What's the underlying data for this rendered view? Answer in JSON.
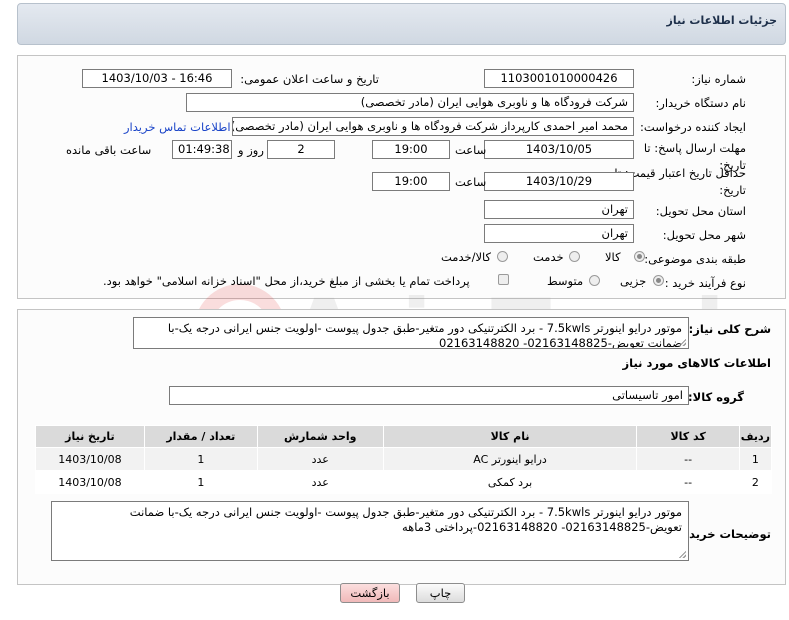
{
  "header": {
    "title": "جزئیات اطلاعات نیاز"
  },
  "form": {
    "need_number_label": "شماره نیاز:",
    "need_number": "1103001010000426",
    "announce_label": "تاریخ و ساعت اعلان عمومی:",
    "announce_value": "1403/10/03 - 16:46",
    "buyer_org_label": "نام دستگاه خریدار:",
    "buyer_org": "شرکت فرودگاه ها و ناوبری هوایی ایران (مادر تخصصی)",
    "creator_label": "ایجاد کننده درخواست:",
    "creator": "محمد امیر احمدی کارپرداز شرکت فرودگاه ها و ناوبری هوایی ایران (مادر تخصصی)",
    "contact_link": "اطلاعات تماس خریدار",
    "reply_deadline_label": "مهلت ارسال پاسخ: تا تاریخ:",
    "reply_date": "1403/10/05",
    "time_label": "ساعت",
    "reply_time": "19:00",
    "days_value": "2",
    "days_label": "روز و",
    "remaining_time": "01:49:38",
    "remaining_label": "ساعت باقی مانده",
    "price_validity_label": "حداقل تاریخ اعتبار قیمت: تا تاریخ:",
    "price_date": "1403/10/29",
    "price_time": "19:00",
    "province_label": "استان محل تحویل:",
    "province": "تهران",
    "city_label": "شهر محل تحویل:",
    "city": "تهران",
    "category_label": "طبقه بندی موضوعی:",
    "category_options": [
      "کالا",
      "خدمت",
      "کالا/خدمت"
    ],
    "category_selected": "کالا",
    "purchase_type_label": "نوع فرآیند خرید :",
    "purchase_options": [
      "جزیی",
      "متوسط"
    ],
    "purchase_selected": "جزیی",
    "payment_note": "پرداخت تمام یا بخشی از مبلغ خرید،از محل \"اسناد خزانه اسلامی\" خواهد بود."
  },
  "summary": {
    "label": "شرح کلی نیاز:",
    "text": "موتور درایو اینورتر 7.5kwls - برد الکترتنیکی دور متغیر-طبق جدول پیوست -اولویت جنس ایرانی درجه یک-با ضمانت تعویض-02163148825- 02163148820"
  },
  "goods": {
    "section_title": "اطلاعات کالاهای مورد نیاز",
    "group_label": "گروه کالا:",
    "group_value": "امور تاسیساتی",
    "columns": [
      "ردیف",
      "کد کالا",
      "نام کالا",
      "واحد شمارش",
      "تعداد / مقدار",
      "تاریخ نیاز"
    ],
    "rows": [
      {
        "idx": "1",
        "code": "--",
        "name": "درایو اینورتر AC",
        "unit": "عدد",
        "qty": "1",
        "date": "1403/10/08"
      },
      {
        "idx": "2",
        "code": "--",
        "name": "برد کمکی",
        "unit": "عدد",
        "qty": "1",
        "date": "1403/10/08"
      }
    ]
  },
  "buyer_notes": {
    "label": "توضیحات خریدار:",
    "text": "موتور درایو اینورتر 7.5kwls - برد الکترتنیکی دور متغیر-طبق جدول پیوست -اولویت جنس ایرانی درجه یک-با ضمانت تعویض-02163148825- 02163148820-پرداختی 3ماهه"
  },
  "buttons": {
    "print": "چاپ",
    "back": "بازگشت"
  },
  "watermark": {
    "text": "AriaTender.neT"
  },
  "colors": {
    "link": "#1a44c8",
    "back_button": "#f5c7c7"
  }
}
